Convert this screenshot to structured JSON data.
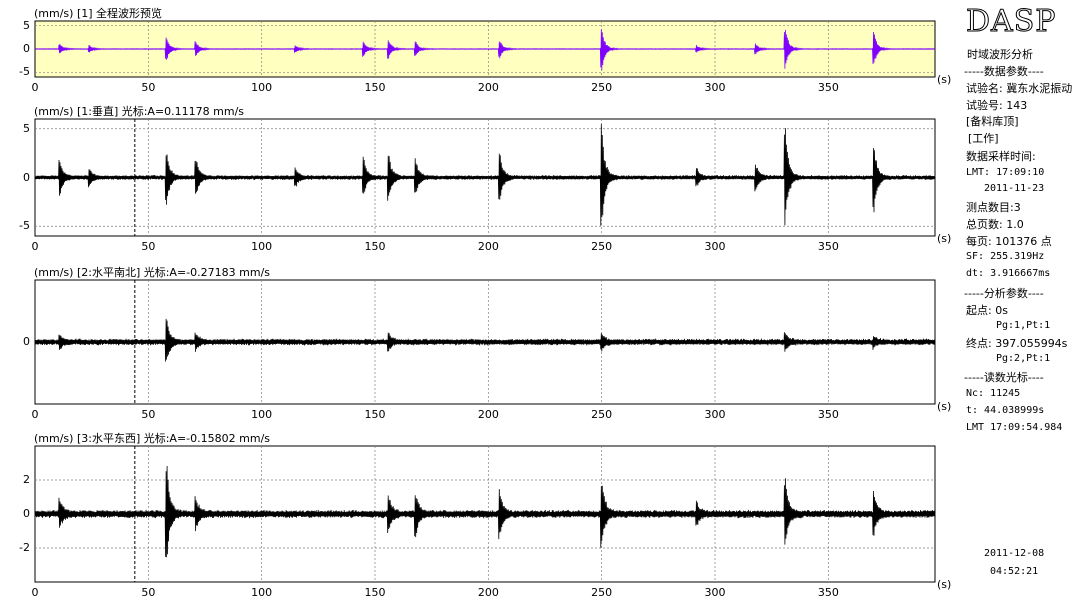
{
  "app": {
    "logo": "DASP"
  },
  "panels": [
    {
      "title": "(mm/s)  [1] 全程波形预览",
      "ticks_y": [
        "5",
        "0",
        "-5"
      ],
      "fill": "#ffffc0",
      "color": "#7f00ff"
    },
    {
      "title": "(mm/s)  [1:垂直] 光标:A=0.11178 mm/s",
      "ticks_y": [
        "5",
        "0",
        "-5"
      ],
      "fill": "#ffffff",
      "color": "#000000"
    },
    {
      "title": "(mm/s)  [2:水平南北] 光标:A=-0.27183 mm/s",
      "ticks_y": [
        "0"
      ],
      "fill": "#ffffff",
      "color": "#000000"
    },
    {
      "title": "(mm/s)  [3:水平东西] 光标:A=-0.15802 mm/s",
      "ticks_y": [
        "2",
        "0",
        "-2"
      ],
      "fill": "#ffffff",
      "color": "#000000"
    }
  ],
  "x_ticks": [
    "0",
    "50",
    "100",
    "150",
    "200",
    "250",
    "300",
    "350"
  ],
  "x_unit": "(s)",
  "info": {
    "l1": "时域波形分析",
    "l2": "-----数据参数----",
    "l3": "试验名: 冀东水泥振动",
    "l4": "试验号: 143",
    "l5": "[备料库顶]",
    "l6": "[工作]",
    "l7": "数据采样时间:",
    "l8": "LMT: 17:09:10",
    "l9": "2011-11-23",
    "l10": "测点数目:3",
    "l11": "总页数: 1.0",
    "l12": "每页: 101376 点",
    "l13": "SF: 255.319Hz",
    "l14": "dt: 3.916667ms",
    "l15": "-----分析参数----",
    "l16": "起点: 0s",
    "l17": "Pg:1,Pt:1",
    "l18": "终点: 397.055994s",
    "l19": "Pg:2,Pt:1",
    "l20": "-----读数光标----",
    "l21": "Nc: 11245",
    "l22": "t: 44.038999s",
    "l23": "LMT 17:09:54.984",
    "date": "2011-12-08",
    "time": "04:52:21"
  },
  "chart_data": [
    {
      "type": "line",
      "title": "[1] 全程波形预览",
      "ylabel": "(mm/s)",
      "xlabel": "(s)",
      "xlim": [
        0,
        397.06
      ],
      "ylim": [
        -6,
        6
      ],
      "events_t": [
        11,
        24,
        58,
        71,
        115,
        145,
        156,
        168,
        205,
        250,
        292,
        318,
        331,
        370
      ],
      "events_a": [
        1.2,
        0.8,
        2.8,
        1.8,
        0.8,
        1.6,
        2.2,
        1.6,
        2.0,
        5.0,
        0.8,
        1.2,
        5.0,
        4.0
      ]
    },
    {
      "type": "line",
      "title": "[1:垂直]",
      "ylabel": "(mm/s)",
      "xlabel": "(s)",
      "xlim": [
        0,
        397.06
      ],
      "ylim": [
        -6,
        6
      ],
      "cursor_t": 44.039,
      "events_t": [
        11,
        24,
        58,
        71,
        115,
        145,
        156,
        168,
        205,
        250,
        292,
        318,
        331,
        370
      ],
      "events_a": [
        1.8,
        0.9,
        2.9,
        2.1,
        0.9,
        1.9,
        2.4,
        1.8,
        2.7,
        5.3,
        0.8,
        1.3,
        5.2,
        3.9
      ]
    },
    {
      "type": "line",
      "title": "[2:水平南北]",
      "ylabel": "(mm/s)",
      "xlabel": "(s)",
      "xlim": [
        0,
        397.06
      ],
      "ylim": [
        -4,
        4
      ],
      "cursor_t": 44.039,
      "events_t": [
        11,
        58,
        71,
        156,
        250,
        331,
        370
      ],
      "events_a": [
        0.4,
        1.5,
        0.5,
        0.5,
        0.5,
        0.5,
        0.3
      ]
    },
    {
      "type": "line",
      "title": "[3:水平东西]",
      "ylabel": "(mm/s)",
      "xlabel": "(s)",
      "xlim": [
        0,
        397.06
      ],
      "ylim": [
        -4,
        4
      ],
      "cursor_t": 44.039,
      "events_t": [
        11,
        58,
        71,
        156,
        168,
        205,
        250,
        292,
        331,
        370
      ],
      "events_a": [
        0.8,
        3.2,
        0.9,
        1.0,
        1.3,
        1.3,
        2.1,
        0.6,
        2.1,
        1.2
      ]
    }
  ]
}
